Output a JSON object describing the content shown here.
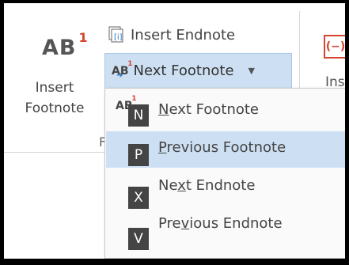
{
  "ribbon": {
    "insert_footnote_label_line1": "Insert",
    "insert_footnote_label_line2": "Footnote",
    "insert_endnote_label": "Insert Endnote",
    "next_footnote_label": "Next Footnote",
    "right_partial_label": "Ins",
    "group_label_partial": "F"
  },
  "menu": {
    "items": [
      {
        "label_prefix": "",
        "access": "N",
        "label_suffix": "ext Footnote",
        "keytip": "N"
      },
      {
        "label_prefix": "",
        "access": "P",
        "label_suffix": "revious Footnote",
        "keytip": "P"
      },
      {
        "label_prefix": "Ne",
        "access": "x",
        "label_suffix": "t Endnote",
        "keytip": "X"
      },
      {
        "label_prefix": "Pre",
        "access": "v",
        "label_suffix": "ious Endnote",
        "keytip": "V"
      }
    ]
  },
  "colors": {
    "accent": "#d6452f",
    "highlight": "#cde0f3",
    "keytip_bg": "#444444"
  }
}
